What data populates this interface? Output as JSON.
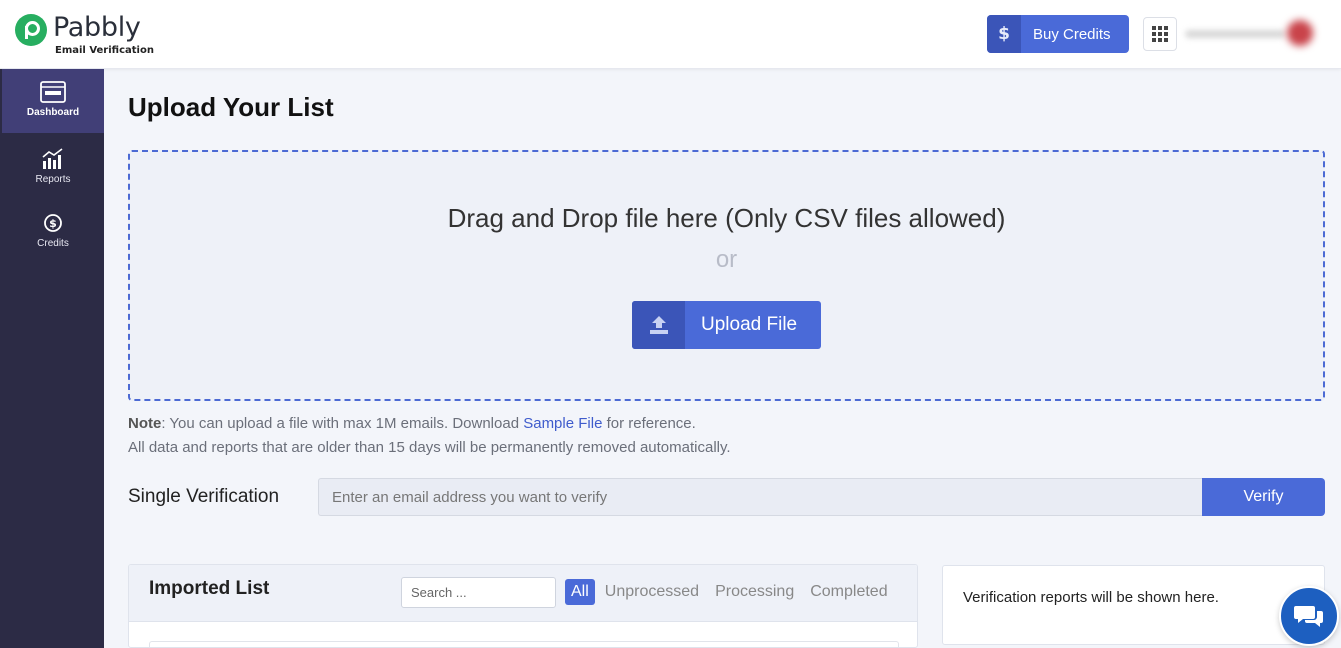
{
  "header": {
    "logo_name": "Pabbly",
    "logo_subtitle": "Email Verification",
    "buy_credits_label": "Buy Credits",
    "buy_credits_icon": "$",
    "apps_icon": "grid-icon",
    "brand_color": "#4a6ad8"
  },
  "sidebar": {
    "items": [
      {
        "label": "Dashboard",
        "icon": "dashboard-icon",
        "active": true
      },
      {
        "label": "Reports",
        "icon": "chart-icon",
        "active": false
      },
      {
        "label": "Credits",
        "icon": "dollar-circle-icon",
        "active": false
      }
    ],
    "background": "#2c2b45",
    "active_background": "#413f77"
  },
  "main": {
    "title": "Upload Your List",
    "dropzone": {
      "text": "Drag and Drop file here (Only CSV files allowed)",
      "or": "or",
      "upload_label": "Upload File"
    },
    "note": {
      "prefix": "Note",
      "text_before_link": ": You can upload a file with max 1M emails. Download ",
      "link": "Sample File",
      "text_after_link": " for reference.",
      "line2": "All data and reports that are older than 15 days will be permanently removed automatically."
    },
    "single_verification": {
      "label": "Single Verification",
      "placeholder": "Enter an email address you want to verify",
      "value": "",
      "button": "Verify"
    },
    "imported_list": {
      "title": "Imported List",
      "search_placeholder": "Search ...",
      "filters": [
        {
          "label": "All",
          "active": true
        },
        {
          "label": "Unprocessed",
          "active": false
        },
        {
          "label": "Processing",
          "active": false
        },
        {
          "label": "Completed",
          "active": false
        }
      ]
    },
    "reports_panel": {
      "text": "Verification reports will be shown here."
    }
  },
  "chat": {
    "icon": "chat-bubbles-icon"
  }
}
